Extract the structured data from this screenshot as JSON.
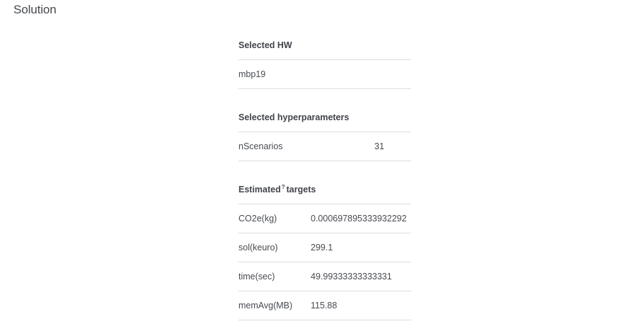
{
  "section": {
    "title": "Solution"
  },
  "hw": {
    "header": "Selected HW",
    "value": "mbp19"
  },
  "hyperparameters": {
    "header": "Selected hyperparameters",
    "rows": [
      {
        "name": "nScenarios",
        "value": "31"
      }
    ]
  },
  "targets": {
    "header_prefix": "Estimated",
    "header_marker": "?",
    "header_suffix": "targets",
    "rows": [
      {
        "name": "CO2e(kg)",
        "value": "0.000697895333932292"
      },
      {
        "name": "sol(keuro)",
        "value": "299.1"
      },
      {
        "name": "time(sec)",
        "value": "49.99333333333331"
      },
      {
        "name": "memAvg(MB)",
        "value": "115.88"
      }
    ]
  }
}
